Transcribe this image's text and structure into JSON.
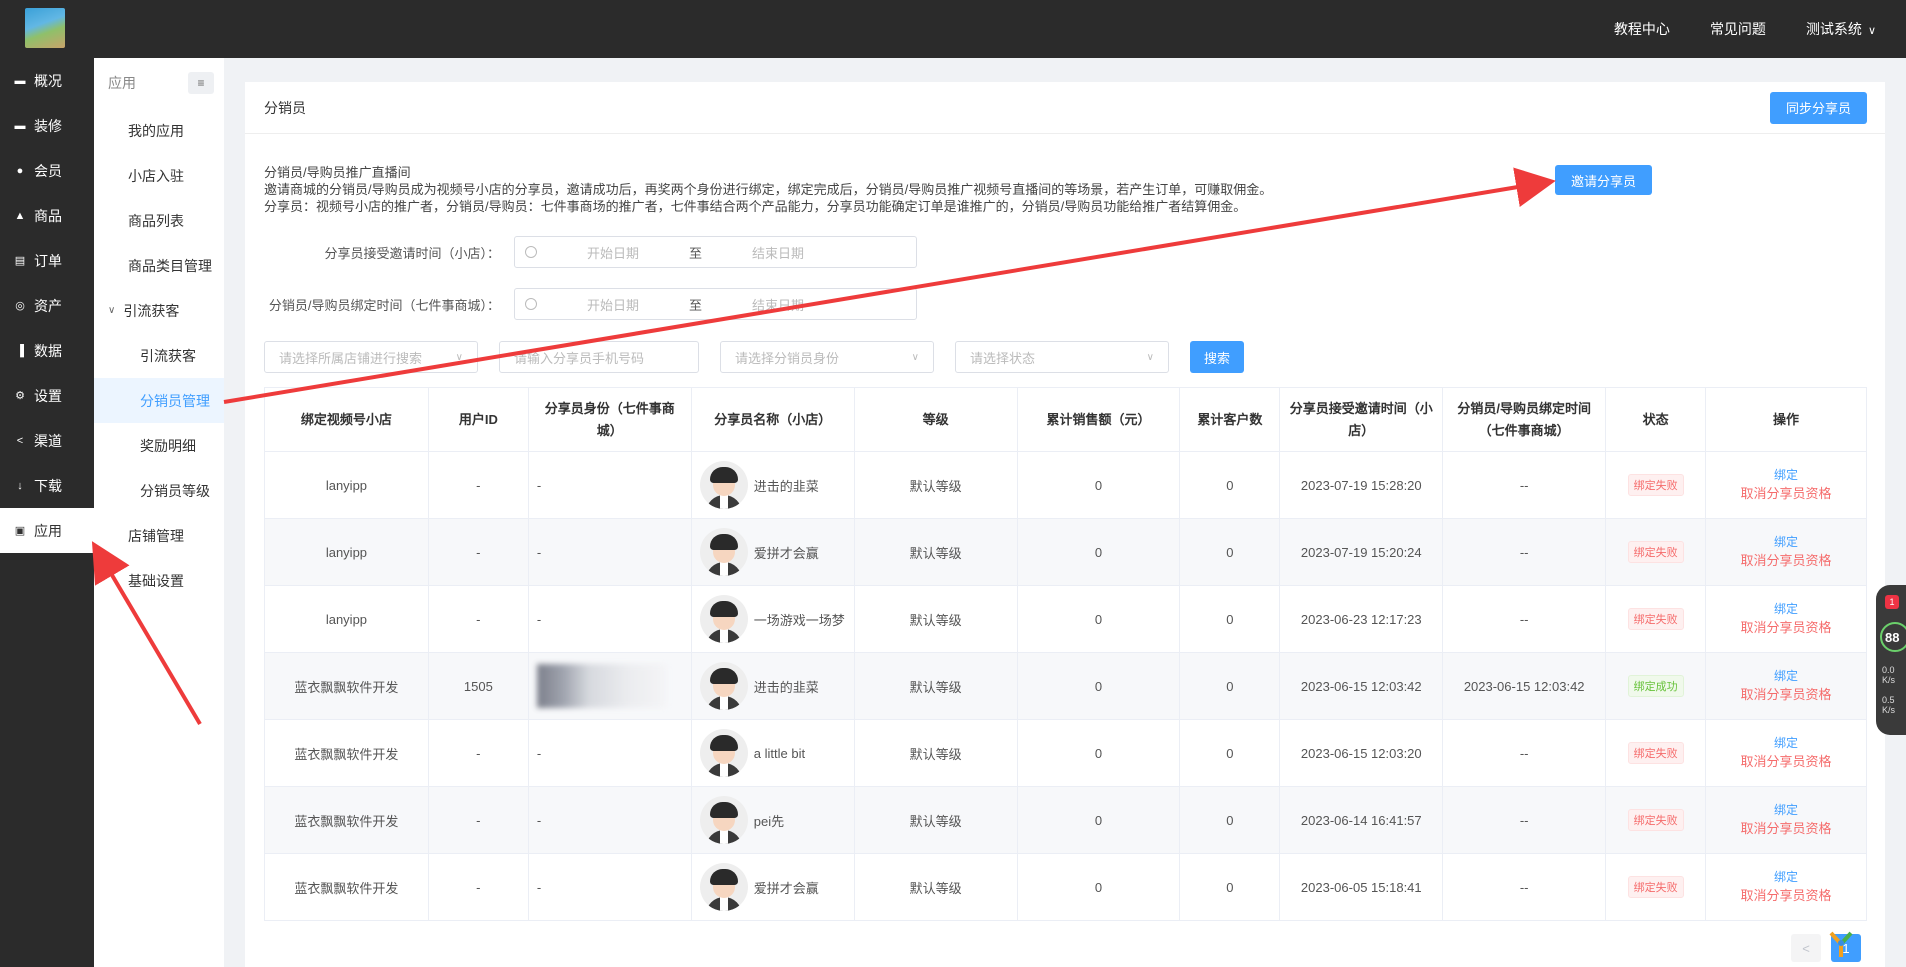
{
  "header": {
    "nav": [
      "教程中心",
      "常见问题",
      "测试系统"
    ]
  },
  "side1": {
    "items": [
      {
        "icon": "monitor-icon",
        "label": "概况"
      },
      {
        "icon": "monitor-icon",
        "label": "装修"
      },
      {
        "icon": "user-icon",
        "label": "会员"
      },
      {
        "icon": "shop-icon",
        "label": "商品"
      },
      {
        "icon": "doc-icon",
        "label": "订单"
      },
      {
        "icon": "db-icon",
        "label": "资产"
      },
      {
        "icon": "bar-icon",
        "label": "数据"
      },
      {
        "icon": "gear-icon",
        "label": "设置"
      },
      {
        "icon": "share-icon",
        "label": "渠道"
      },
      {
        "icon": "download-icon",
        "label": "下载"
      },
      {
        "icon": "app-icon",
        "label": "应用"
      }
    ]
  },
  "side2": {
    "title": "应用",
    "items": [
      "我的应用",
      "小店入驻",
      "商品列表",
      "商品类目管理"
    ],
    "group": "引流获客",
    "subs": [
      "引流获客",
      "分销员管理",
      "奖励明细",
      "分销员等级"
    ],
    "tail": [
      "店铺管理",
      "基础设置"
    ]
  },
  "card": {
    "title": "分销员",
    "sync_btn": "同步分享员",
    "invite_btn": "邀请分享员",
    "intro": [
      "分销员/导购员推广直播间",
      "邀请商城的分销员/导购员成为视频号小店的分享员，邀请成功后，再奖两个身份进行绑定，绑定完成后，分销员/导购员推广视频号直播间的等场景，若产生订单，可赚取佣金。",
      "分享员：视频号小店的推广者，分销员/导购员：七件事商场的推广者，七件事结合两个产品能力，分享员功能确定订单是谁推广的，分销员/导购员功能给推广者结算佣金。"
    ],
    "form": {
      "label1": "分享员接受邀请时间（小店）：",
      "label2": "分销员/导购员绑定时间（七件事商城）：",
      "start": "开始日期",
      "to": "至",
      "end": "结束日期"
    },
    "filters": {
      "shop": "请选择所属店铺进行搜索",
      "phone": "请输入分享员手机号码",
      "role": "请选择分销员身份",
      "status": "请选择状态",
      "search": "搜索"
    }
  },
  "table": {
    "headers": [
      "绑定视频号小店",
      "用户ID",
      "分享员身份（七件事商城）",
      "分享员名称（小店）",
      "等级",
      "累计销售额（元）",
      "累计客户数",
      "分享员接受邀请时间（小店）",
      "分销员/导购员绑定时间（七件事商城）",
      "状态",
      "操作"
    ],
    "rows": [
      {
        "shop": "lanyipp",
        "uid": "-",
        "role": "-",
        "name": "进击的韭菜",
        "level": "默认等级",
        "sales": "0",
        "customers": "0",
        "invite_time": "2023-07-19 15:28:20",
        "bind_time": "--",
        "status": "绑定失败",
        "ok": false
      },
      {
        "shop": "lanyipp",
        "uid": "-",
        "role": "-",
        "name": "爱拼才会赢",
        "level": "默认等级",
        "sales": "0",
        "customers": "0",
        "invite_time": "2023-07-19 15:20:24",
        "bind_time": "--",
        "status": "绑定失败",
        "ok": false
      },
      {
        "shop": "lanyipp",
        "uid": "-",
        "role": "-",
        "name": "一场游戏一场梦",
        "level": "默认等级",
        "sales": "0",
        "customers": "0",
        "invite_time": "2023-06-23 12:17:23",
        "bind_time": "--",
        "status": "绑定失败",
        "ok": false
      },
      {
        "shop": "蓝衣飘飘软件开发",
        "uid": "1505",
        "role": "",
        "name": "进击的韭菜",
        "level": "默认等级",
        "sales": "0",
        "customers": "0",
        "invite_time": "2023-06-15 12:03:42",
        "bind_time": "2023-06-15 12:03:42",
        "status": "绑定成功",
        "ok": true
      },
      {
        "shop": "蓝衣飘飘软件开发",
        "uid": "-",
        "role": "-",
        "name": "a little bit",
        "level": "默认等级",
        "sales": "0",
        "customers": "0",
        "invite_time": "2023-06-15 12:03:20",
        "bind_time": "--",
        "status": "绑定失败",
        "ok": false
      },
      {
        "shop": "蓝衣飘飘软件开发",
        "uid": "-",
        "role": "-",
        "name": "pei先",
        "level": "默认等级",
        "sales": "0",
        "customers": "0",
        "invite_time": "2023-06-14 16:41:57",
        "bind_time": "--",
        "status": "绑定失败",
        "ok": false
      },
      {
        "shop": "蓝衣飘飘软件开发",
        "uid": "-",
        "role": "-",
        "name": "爱拼才会赢",
        "level": "默认等级",
        "sales": "0",
        "customers": "0",
        "invite_time": "2023-06-05 15:18:41",
        "bind_time": "--",
        "status": "绑定失败",
        "ok": false
      }
    ],
    "op_bind": "绑定",
    "op_cancel": "取消分享员资格"
  },
  "pager": {
    "prev": "<",
    "current": "1"
  },
  "widget": {
    "badge": "1",
    "score": "88",
    "up": "0.0",
    "up_unit": "K/s",
    "down": "0.5",
    "down_unit": "K/s"
  },
  "colors": {
    "primary": "#409eff",
    "danger": "#f56c6c",
    "success": "#67c23a",
    "arrow": "#ee3b3b",
    "dark": "#2b2b2b"
  }
}
